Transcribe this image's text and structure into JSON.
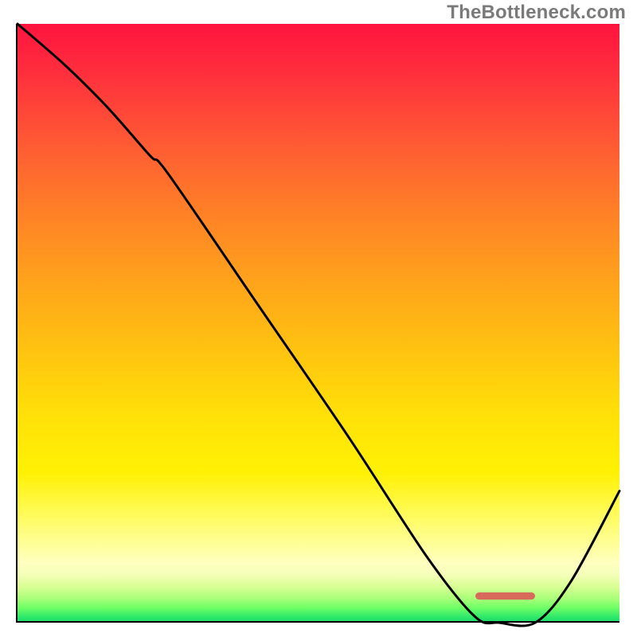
{
  "watermark": "TheBottleneck.com",
  "colors": {
    "curve": "#000000",
    "marker": "#d86a5c",
    "axis": "#000000"
  },
  "chart_data": {
    "type": "line",
    "title": "",
    "xlabel": "",
    "ylabel": "",
    "xlim": [
      0,
      100
    ],
    "ylim": [
      0,
      100
    ],
    "x": [
      0,
      8,
      15,
      22,
      25,
      40,
      55,
      68,
      76,
      80,
      86,
      92,
      100
    ],
    "y": [
      100,
      93,
      86,
      78,
      75,
      53,
      31,
      11,
      1,
      0,
      0,
      7,
      22
    ],
    "marker_range_x": [
      76,
      86
    ],
    "marker_y": 0.6,
    "annotations": []
  }
}
